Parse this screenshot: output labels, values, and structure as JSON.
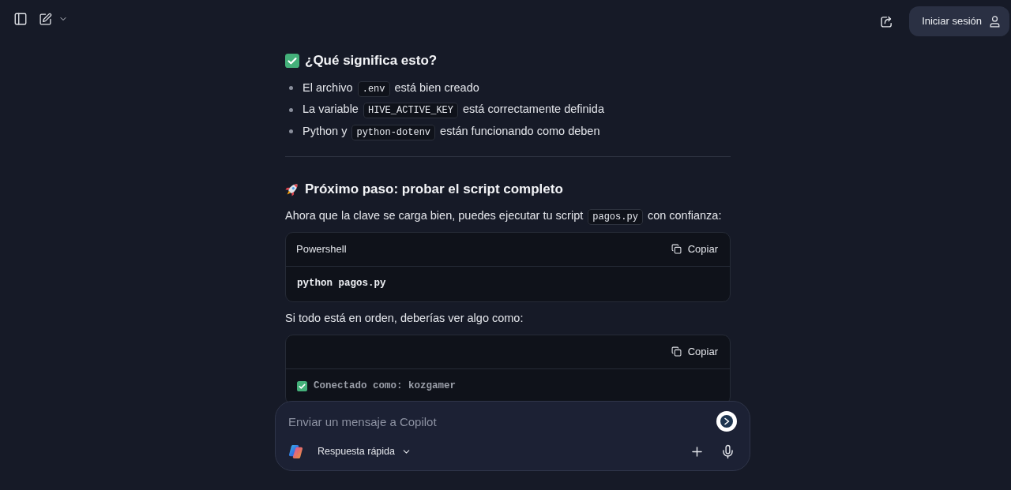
{
  "header": {
    "sign_in_button": "Iniciar sesión"
  },
  "sections": [
    {
      "kind": "heading",
      "text": "¿Qué significa esto?"
    },
    {
      "kind": "bullets",
      "items": [
        [
          {
            "text": "El archivo "
          },
          {
            "code": ".env"
          },
          {
            "text": " está bien creado"
          }
        ],
        [
          {
            "text": "La variable "
          },
          {
            "code": "HIVE_ACTIVE_KEY"
          },
          {
            "text": " está correctamente definida"
          }
        ],
        [
          {
            "text": "Python y "
          },
          {
            "code": "python-dotenv"
          },
          {
            "text": " están funcionando como deben"
          }
        ]
      ]
    },
    {
      "kind": "divider"
    },
    {
      "kind": "heading",
      "text": "Próximo paso: probar el script completo"
    },
    {
      "kind": "paragraph",
      "segments": [
        {
          "text": "Ahora que la clave se carga bien, puedes ejecutar tu script "
        },
        {
          "code": "pagos.py"
        },
        {
          "text": " con confianza:"
        }
      ]
    },
    {
      "kind": "code_block",
      "language": "Powershell",
      "copy_label": "Copiar",
      "code": "python pagos.py"
    },
    {
      "kind": "paragraph",
      "segments": [
        {
          "text": "Si todo está en orden, deberías ver algo como:"
        }
      ]
    },
    {
      "kind": "output_block",
      "copy_label": "Copiar",
      "code": "Conectado como: kozgamer"
    }
  ],
  "composer": {
    "placeholder": "Enviar un mensaje a Copilot",
    "mode": "Respuesta rápida"
  }
}
